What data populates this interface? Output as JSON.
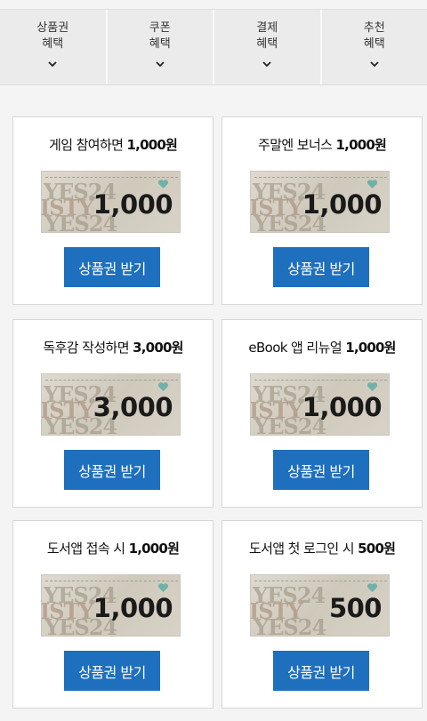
{
  "tabs": [
    {
      "line1": "상품권",
      "line2": "혜택"
    },
    {
      "line1": "쿠폰",
      "line2": "혜택"
    },
    {
      "line1": "결제",
      "line2": "혜택"
    },
    {
      "line1": "추천",
      "line2": "혜택"
    }
  ],
  "ticket_watermark": [
    "YES24",
    "ISTY",
    "YES24"
  ],
  "cards": [
    {
      "title": "게임 참여하면",
      "title_amount": "1,000원",
      "ticket_amount": "1,000",
      "button": "상품권 받기"
    },
    {
      "title": "주말엔 보너스",
      "title_amount": "1,000원",
      "ticket_amount": "1,000",
      "button": "상품권 받기"
    },
    {
      "title": "독후감 작성하면",
      "title_amount": "3,000원",
      "ticket_amount": "3,000",
      "button": "상품권 받기"
    },
    {
      "title": "eBook 앱 리뉴얼",
      "title_amount": "1,000원",
      "ticket_amount": "1,000",
      "button": "상품권 받기"
    },
    {
      "title": "도서앱 접속 시",
      "title_amount": "1,000원",
      "ticket_amount": "1,000",
      "button": "상품권 받기"
    },
    {
      "title": "도서앱 첫 로그인 시",
      "title_amount": "500원",
      "ticket_amount": "500",
      "button": "상품권 받기"
    }
  ],
  "colors": {
    "button": "#1e6fbe",
    "tab_bg": "#ebebeb",
    "page_bg": "#f4f4f4"
  }
}
